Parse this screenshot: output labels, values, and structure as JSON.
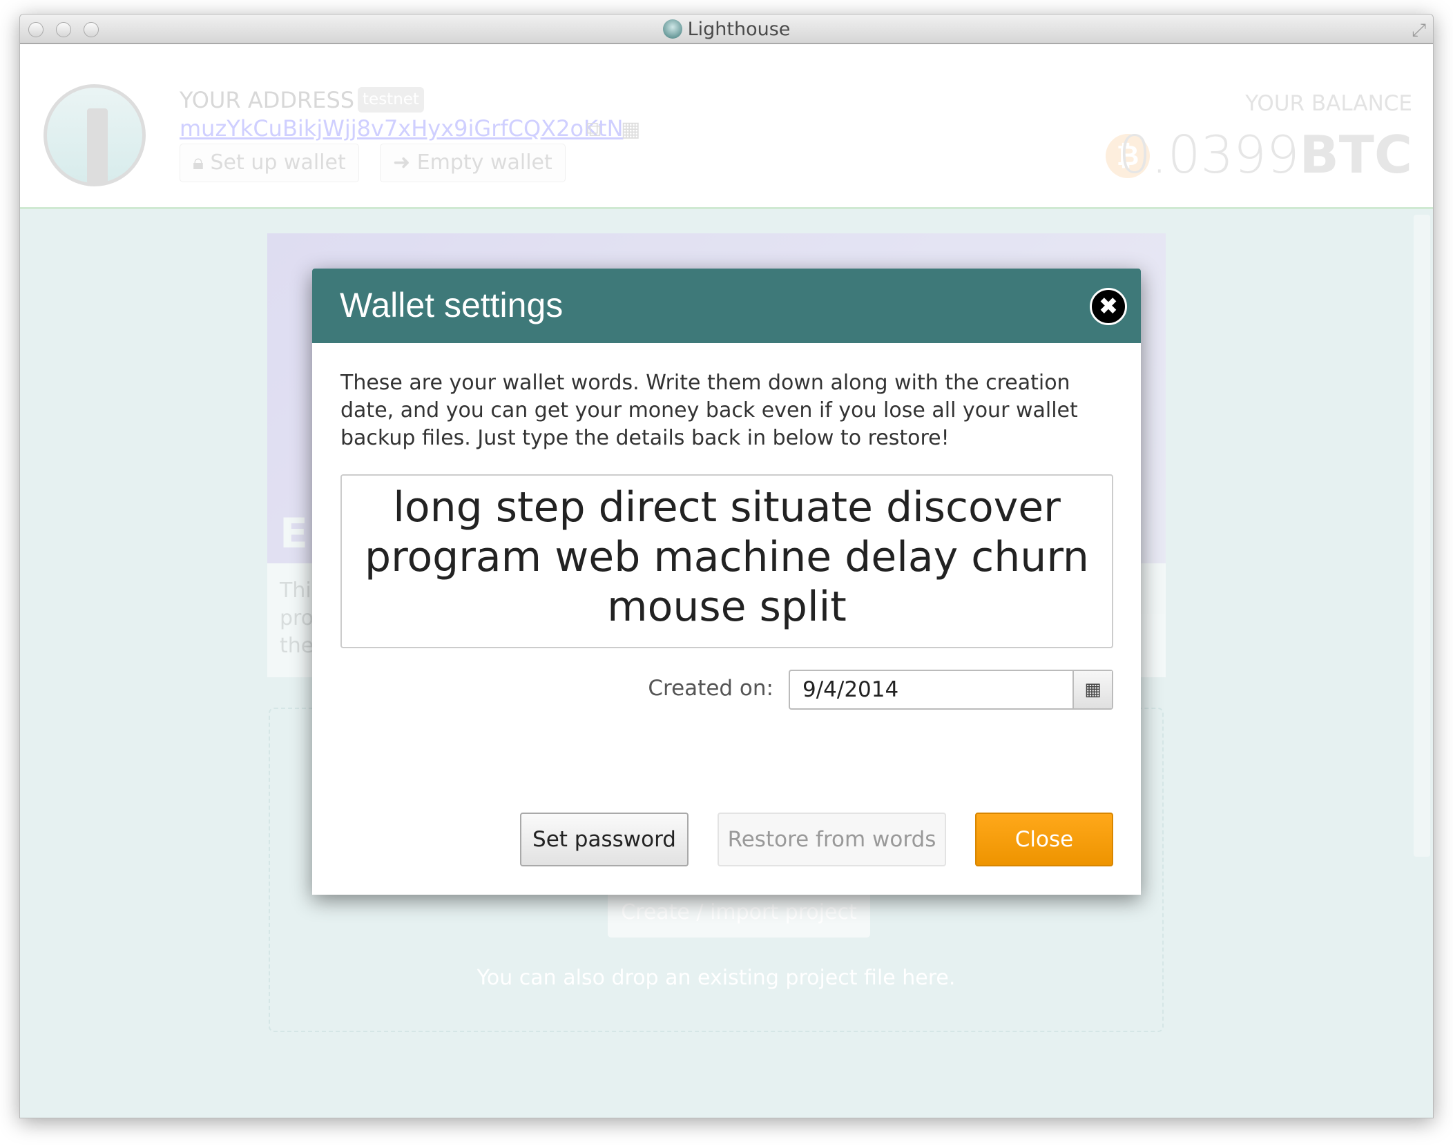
{
  "window": {
    "title": "Lighthouse"
  },
  "header": {
    "address_label": "YOUR ADDRESS",
    "network_badge": "testnet",
    "address": "muzYkCuBikjWjj8v7xHyx9iGrfCQX2oKtN",
    "setup_wallet": "Set up wallet",
    "empty_wallet": "Empty wallet",
    "balance_label": "YOUR BALANCE",
    "balance_amount": "0.0399",
    "balance_unit": "BTC"
  },
  "background": {
    "card_title_fragment": "E",
    "card_text_fragments": [
      "Thi",
      "pro",
      "the"
    ],
    "create_project": "Create / import project",
    "drop_hint": "You can also drop an existing project file here."
  },
  "modal": {
    "title": "Wallet settings",
    "description": "These are your wallet words. Write them down along with the creation date, and you can get your money back even if you lose all your wallet backup files. Just type the details back in below to restore!",
    "words": "long step direct situate discover program web machine delay churn mouse split",
    "created_label": "Created on:",
    "created_date": "9/4/2014",
    "set_password": "Set password",
    "restore": "Restore from words",
    "close": "Close"
  },
  "colors": {
    "modal_header": "#3e7979",
    "accent": "#f39c12"
  }
}
